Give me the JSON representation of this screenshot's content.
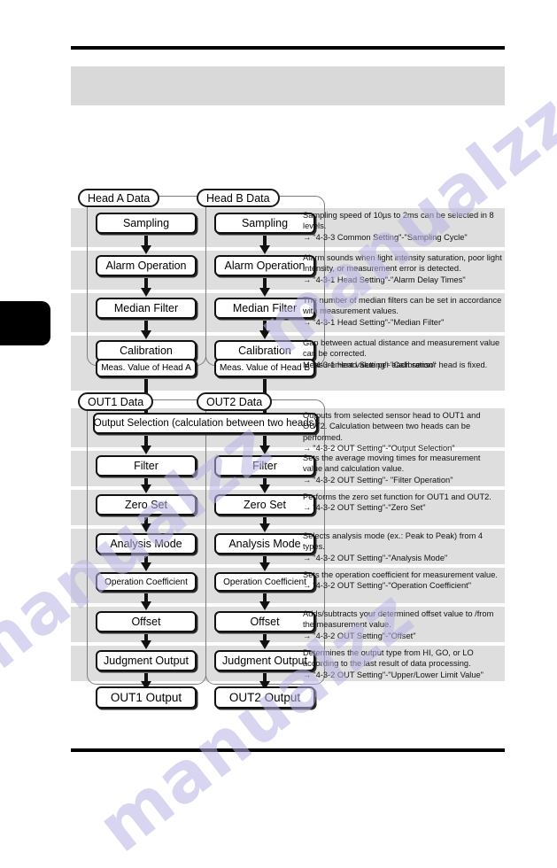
{
  "page": {
    "header_band_label": "",
    "chapter_tab_label": ""
  },
  "diagram": {
    "head_group_a_label": "Head A Data",
    "head_group_b_label": "Head B Data",
    "out_group_1_label": "OUT1 Data",
    "out_group_2_label": "OUT2 Data",
    "head_nodes_a": [
      "Sampling",
      "Alarm Operation",
      "Median Filter",
      "Calibration"
    ],
    "head_nodes_b": [
      "Sampling",
      "Alarm Operation",
      "Median Filter",
      "Calibration"
    ],
    "meas_value_a": "Meas. Value of Head A",
    "meas_value_b": "Meas. Value of Head B",
    "output_selection": "Output Selection (calculation between two heads)",
    "out_nodes_1": [
      "Filter",
      "Zero Set",
      "Analysis Mode",
      "Operation Coefficient",
      "Offset",
      "Judgment Output"
    ],
    "out_nodes_2": [
      "Filter",
      "Zero Set",
      "Analysis Mode",
      "Operation Coefficient",
      "Offset",
      "Judgment Output"
    ],
    "out1_output": "OUT1 Output",
    "out2_output": "OUT2 Output",
    "descriptions": [
      {
        "body": "Sampling speed of 10µs to 2ms can be selected in 8 levels.",
        "ref": "\"4-3-3 Common Setting\"-\"Sampling Cycle\""
      },
      {
        "body": "Alarm sounds when light intensity saturation, poor light intensity, or measurement error is detected.",
        "ref": "\"4-3-1 Head Setting\"-\"Alarm Delay Times\""
      },
      {
        "body": "The number of median filters can be set in accordance with measurement values.",
        "ref": "\"4-3-1 Head Setting\"-\"Median Filter\""
      },
      {
        "body": "Gap between actual distance and measurement value can be corrected.",
        "ref": "\"4-3-1 Head Setting\"-\"Calibration\""
      },
      {
        "body": "Measurement value per each sensor head is fixed.",
        "ref": ""
      },
      {
        "body": "Outputs from selected sensor head to OUT1 and OUT2. Calculation between two heads can be performed.",
        "ref": "\"4-3-2 OUT Setting\"-\"Output Selection\""
      },
      {
        "body": "Sets the average moving times for measurement value and calculation value.",
        "ref": "\"4-3-2 OUT Setting\"- \"Filter Operation\""
      },
      {
        "body": "Performs the zero set function for OUT1 and OUT2.",
        "ref": "\"4-3-2 OUT Setting\"-\"Zero Set\""
      },
      {
        "body": "Selects analysis mode (ex.: Peak to Peak) from 4 types.",
        "ref": "\"4-3-2 OUT Setting\"-\"Analysis Mode\""
      },
      {
        "body": "Sets the operation coefficient for measurement value.",
        "ref": "\"4-3-2 OUT Setting\"-\"Operation Coefficient\""
      },
      {
        "body": "Adds/subtracts your determined offset value to /from the measurement value.",
        "ref": "\"4-3-2 OUT Setting\"-\"Offset\""
      },
      {
        "body": "Determines the output type from HI, GO, or LO according to the last result of data processing.",
        "ref": "\"4-3-2 OUT Setting\"-\"Upper/Lower Limit Value\""
      }
    ]
  },
  "watermark": {
    "line1": "manualzz",
    "line2": "manualzz",
    "line3": "manualzz"
  }
}
